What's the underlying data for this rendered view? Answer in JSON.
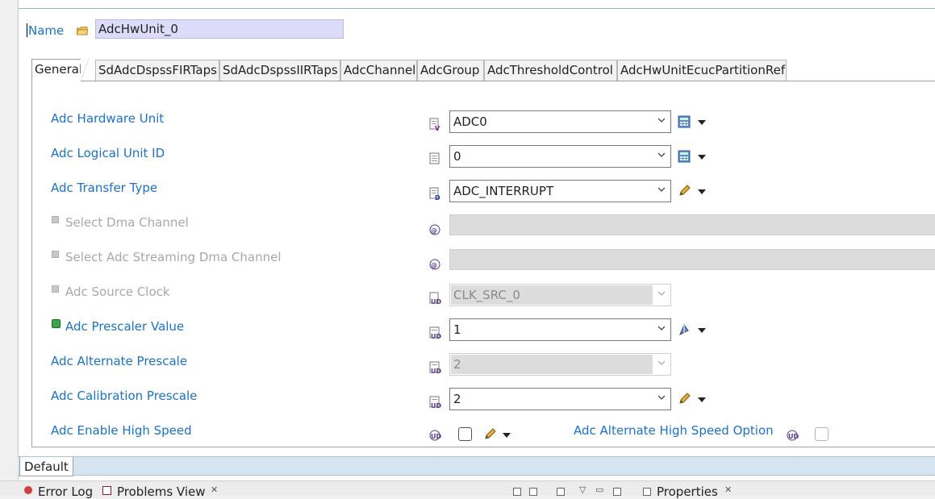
{
  "editor": {
    "name_label": "Name",
    "name_value": "AdcHwUnit_0"
  },
  "tabs": [
    {
      "label": "General",
      "active": true
    },
    {
      "label": "SdAdcDspssFIRTaps"
    },
    {
      "label": "SdAdcDspssIIRTaps"
    },
    {
      "label": "AdcChannel"
    },
    {
      "label": "AdcGroup"
    },
    {
      "label": "AdcThresholdControl"
    },
    {
      "label": "AdcHwUnitEcucPartitionRef"
    }
  ],
  "fields": {
    "hw_unit": {
      "label": "Adc Hardware Unit",
      "value": "ADC0"
    },
    "logical_unit": {
      "label": "Adc Logical Unit ID",
      "value": "0"
    },
    "transfer_type": {
      "label": "Adc Transfer Type",
      "value": "ADC_INTERRUPT"
    },
    "dma_channel": {
      "label": "Select Dma Channel",
      "value": ""
    },
    "streaming_dma": {
      "label": "Select Adc Streaming Dma Channel",
      "value": ""
    },
    "source_clock": {
      "label": "Adc Source Clock",
      "value": "CLK_SRC_0"
    },
    "prescaler": {
      "label": "Adc Prescaler Value",
      "value": "1"
    },
    "alt_prescale": {
      "label": "Adc Alternate Prescale",
      "value": "2"
    },
    "calib_prescale": {
      "label": "Adc Calibration Prescale",
      "value": "2"
    },
    "high_speed": {
      "label": "Adc Enable High Speed",
      "checked": false
    },
    "alt_high_speed": {
      "label": "Adc Alternate High Speed Option",
      "checked": false
    }
  },
  "bottom_tab": "Default",
  "views": {
    "error_log": "Error Log",
    "problems": "Problems View",
    "properties": "Properties"
  },
  "colors": {
    "label_blue": "#1a73c8",
    "name_field_bg": "#dcdcf8",
    "disabled_fill": "#dcdcdc"
  }
}
